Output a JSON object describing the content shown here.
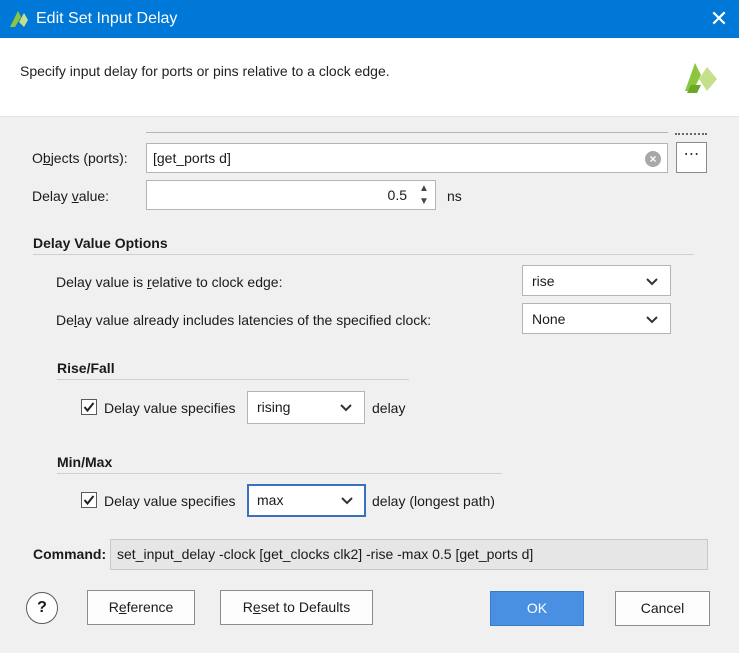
{
  "window": {
    "title": "Edit Set Input Delay",
    "close_glyph": "✕"
  },
  "header": {
    "description": "Specify input delay for ports or pins relative to a clock edge."
  },
  "objects": {
    "label_pre": "O",
    "label_underlined": "b",
    "label_post": "jects (ports):",
    "value": "[get_ports d]",
    "clear_glyph": "×",
    "browse_glyph": "⋯"
  },
  "delay": {
    "label_pre": "Delay ",
    "label_underlined": "v",
    "label_post": "alue:",
    "value": "0.5",
    "unit": "ns",
    "up_glyph": "▲",
    "down_glyph": "▼"
  },
  "delay_options": {
    "title": "Delay Value Options",
    "relative_label_pre": "Delay value is ",
    "relative_label_underlined": "r",
    "relative_label_post": "elative to clock edge:",
    "relative_value": "rise",
    "latency_label_pre": "De",
    "latency_label_underlined": "l",
    "latency_label_post": "ay value already includes latencies of the specified clock:",
    "latency_value": "None"
  },
  "rise_fall": {
    "title": "Rise/Fall",
    "checked": true,
    "label": "Delay value specifies",
    "value": "rising",
    "suffix": "delay"
  },
  "min_max": {
    "title": "Min/Max",
    "checked": true,
    "label": "Delay value specifies",
    "value": "max",
    "suffix": "delay (longest path)"
  },
  "command": {
    "label": "Command:",
    "value": "set_input_delay -clock [get_clocks clk2] -rise -max 0.5 [get_ports d]"
  },
  "buttons": {
    "help": "?",
    "reference_pre": "R",
    "reference_underlined": "e",
    "reference_post": "ference",
    "reset_pre": "R",
    "reset_underlined": "e",
    "reset_post": "set to Defaults",
    "ok": "OK",
    "cancel": "Cancel"
  },
  "colors": {
    "titlebar": "#0078d7",
    "primary_button": "#4a90e2",
    "focus_border": "#3b6fbf",
    "logo_green": "#8cc63f"
  }
}
